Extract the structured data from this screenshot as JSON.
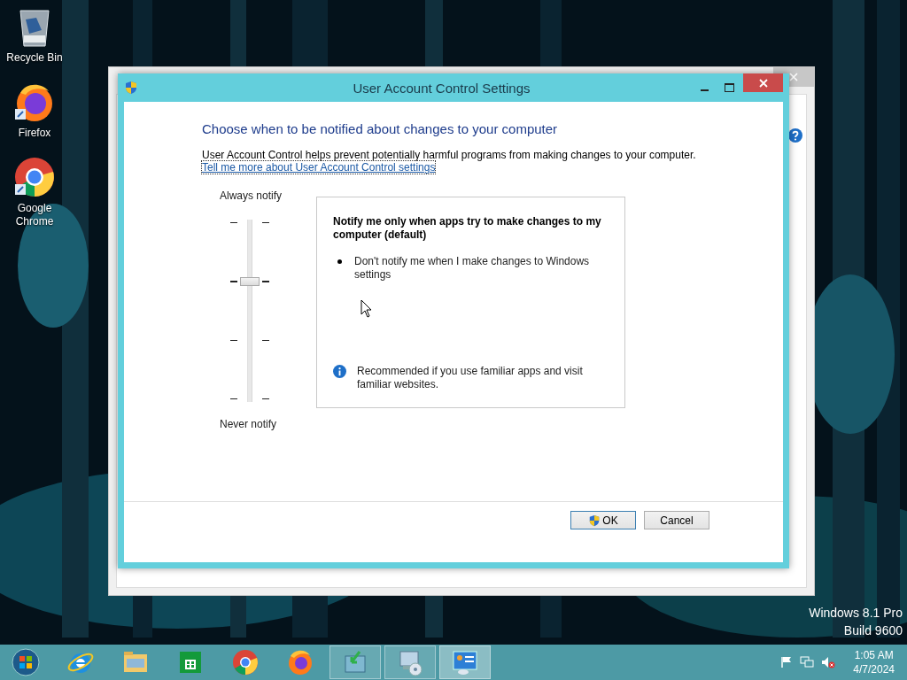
{
  "desktop": {
    "icons": [
      {
        "kind": "recycle",
        "label": "Recycle Bin",
        "shortcut": false
      },
      {
        "kind": "firefox",
        "label": "Firefox",
        "shortcut": true
      },
      {
        "kind": "chrome",
        "label": "Google Chrome",
        "shortcut": true
      }
    ],
    "edition": "Windows 8.1 Pro",
    "build": "Build 9600"
  },
  "dialog": {
    "title": "User Account Control Settings",
    "heading": "Choose when to be notified about changes to your computer",
    "description": "User Account Control helps prevent potentially harmful programs from making changes to your computer.",
    "link": "Tell me more about User Account Control settings",
    "slider": {
      "top_label": "Always notify",
      "bottom_label": "Never notify",
      "level": 0.67
    },
    "info": {
      "title": "Notify me only when apps try to make changes to my computer (default)",
      "bullets": [
        "Don't notify me when I make changes to Windows settings"
      ],
      "recommendation": "Recommended if you use familiar apps and visit familiar websites."
    },
    "buttons": [
      {
        "label": "OK",
        "shield": true,
        "selected": true
      },
      {
        "label": "Cancel",
        "shield": false,
        "selected": false
      }
    ]
  },
  "taskbar": {
    "items": [
      {
        "kind": "start",
        "running": false,
        "selected": false
      },
      {
        "kind": "ie",
        "running": false,
        "selected": false
      },
      {
        "kind": "explorer",
        "running": false,
        "selected": false
      },
      {
        "kind": "store",
        "running": false,
        "selected": false
      },
      {
        "kind": "chrome",
        "running": false,
        "selected": false
      },
      {
        "kind": "firefox",
        "running": false,
        "selected": false
      },
      {
        "kind": "install",
        "running": true,
        "selected": false
      },
      {
        "kind": "disc",
        "running": true,
        "selected": false
      },
      {
        "kind": "control",
        "running": true,
        "selected": true
      }
    ],
    "time": "1:05 AM",
    "date": "4/7/2024"
  }
}
